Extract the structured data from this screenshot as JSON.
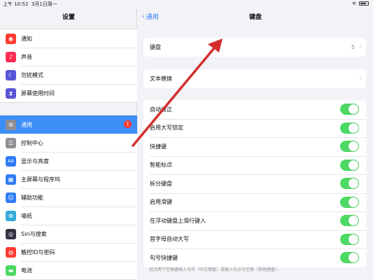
{
  "status_bar": {
    "time": "上午 10:52",
    "date": "3月1日周一"
  },
  "sidebar": {
    "title": "设置",
    "groups": [
      [
        {
          "label": "通知",
          "icon": "bell-icon",
          "color": "#ff3b30",
          "glyph": "◉"
        },
        {
          "label": "声音",
          "icon": "speaker-icon",
          "color": "#ff2d55",
          "glyph": "♪"
        },
        {
          "label": "勿扰模式",
          "icon": "moon-icon",
          "color": "#5856d6",
          "glyph": "☾"
        },
        {
          "label": "屏幕使用时间",
          "icon": "hourglass-icon",
          "color": "#5856d6",
          "glyph": "⧗"
        }
      ],
      [
        {
          "label": "通用",
          "icon": "gear-icon",
          "color": "#8e8e93",
          "glyph": "⚙",
          "active": true,
          "badge": "1"
        },
        {
          "label": "控制中心",
          "icon": "switches-icon",
          "color": "#8e8e93",
          "glyph": "☰"
        },
        {
          "label": "显示与亮度",
          "icon": "text-size-icon",
          "color": "#2f7cf6",
          "glyph": "AA"
        },
        {
          "label": "主屏幕与程序坞",
          "icon": "grid-icon",
          "color": "#2f7cf6",
          "glyph": "▦"
        },
        {
          "label": "辅助功能",
          "icon": "accessibility-icon",
          "color": "#2f7cf6",
          "glyph": "☺"
        },
        {
          "label": "墙纸",
          "icon": "flower-icon",
          "color": "#34aadc",
          "glyph": "✿"
        },
        {
          "label": "Siri与搜索",
          "icon": "siri-icon",
          "color": "#333344",
          "glyph": "◎"
        },
        {
          "label": "触控ID与密码",
          "icon": "fingerprint-icon",
          "color": "#ff3b30",
          "glyph": "◍"
        },
        {
          "label": "电池",
          "icon": "battery-icon",
          "color": "#4cd964",
          "glyph": "▬"
        }
      ]
    ]
  },
  "main": {
    "back_label": "通用",
    "title": "键盘",
    "keyboards": {
      "label": "键盘",
      "value": "5"
    },
    "text_replacement": {
      "label": "文本替换"
    },
    "toggles": [
      {
        "label": "自动改正",
        "on": true
      },
      {
        "label": "启用大写锁定",
        "on": true
      },
      {
        "label": "快捷键",
        "on": true
      },
      {
        "label": "智能标点",
        "on": true
      },
      {
        "label": "拆分键盘",
        "on": true
      },
      {
        "label": "启用滑键",
        "on": true
      },
      {
        "label": "在浮动键盘上滑行键入",
        "on": true
      },
      {
        "label": "首字母自动大写",
        "on": true
      },
      {
        "label": "句号快捷键",
        "on": true
      }
    ],
    "footnote": "轻点两下空格键插入句号（中文键盘）或插入句点与空格（其他键盘）。"
  },
  "colors": {
    "accent": "#2f7cf6",
    "toggle_on": "#4cd964",
    "annotation_arrow": "#d32f2f"
  }
}
